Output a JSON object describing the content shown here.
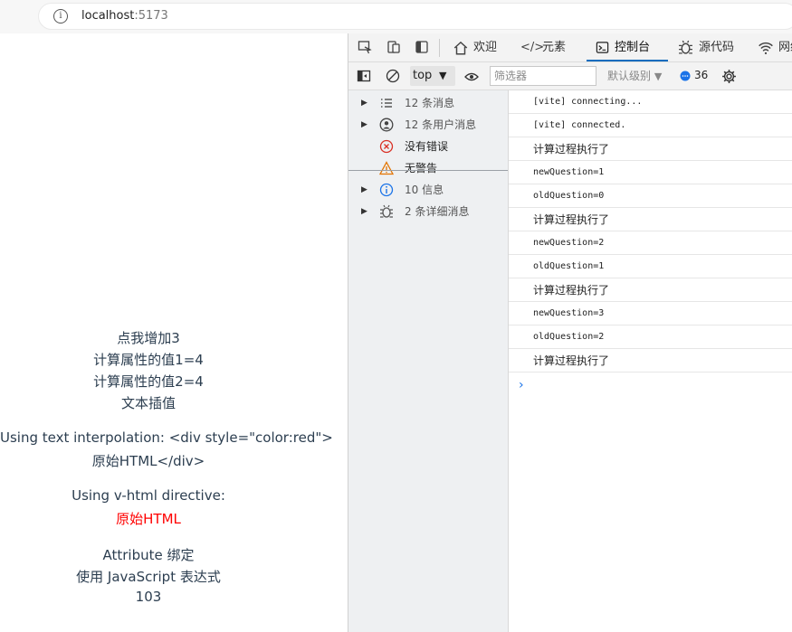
{
  "browser": {
    "host": "localhost",
    "port": ":5173"
  },
  "page": {
    "lines": [
      "点我增加3",
      "计算属性的值1=4",
      "计算属性的值2=4",
      "文本插值",
      "Using text interpolation: <div style=\"color:red\">",
      "原始HTML</div>",
      "Using v-html directive:",
      "原始HTML",
      "Attribute 绑定",
      "使用 JavaScript 表达式",
      "103"
    ],
    "red_color": "#ff0000"
  },
  "devtools": {
    "tabs": [
      "欢迎",
      "元素",
      "控制台",
      "源代码",
      "网络"
    ],
    "toolbar": {
      "context": "top",
      "filter_placeholder": "筛选器",
      "level": "默认级别",
      "count": "36"
    },
    "sidebar": [
      {
        "label": "12 条消息",
        "icon": "list-icon"
      },
      {
        "label": "12 条用户消息",
        "icon": "user-icon"
      },
      {
        "label": "没有错误",
        "icon": "error-icon"
      },
      {
        "label": "无警告",
        "icon": "warning-icon"
      },
      {
        "label": "10 信息",
        "icon": "info-icon"
      },
      {
        "label": "2 条详细消息",
        "icon": "bug-icon"
      }
    ],
    "console": [
      "[vite] connecting...",
      "[vite] connected.",
      "计算过程执行了",
      "newQuestion=1",
      "oldQuestion=0",
      "计算过程执行了",
      "newQuestion=2",
      "oldQuestion=1",
      "计算过程执行了",
      "newQuestion=3",
      "oldQuestion=2",
      "计算过程执行了"
    ],
    "prompt": "›"
  }
}
